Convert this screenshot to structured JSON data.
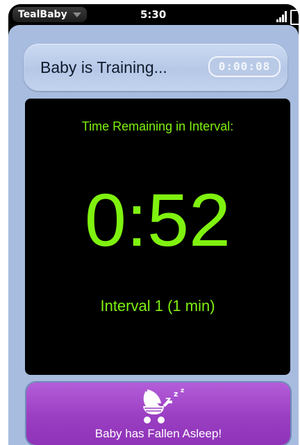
{
  "status_bar": {
    "app_name": "TealBaby",
    "time": "5:30"
  },
  "header": {
    "title": "Baby is Training...",
    "elapsed": "0:00:08"
  },
  "timer": {
    "caption": "Time Remaining in Interval:",
    "value": "0:52",
    "interval_label": "Interval 1 (1 min)"
  },
  "asleep_button": {
    "label": "Baby has Fallen Asleep!",
    "icon": "sleeping-stroller-icon"
  },
  "colors": {
    "timer_green": "#7ff20f",
    "button_purple": "#9a3ec2",
    "app_background": "#a7bcdf"
  }
}
